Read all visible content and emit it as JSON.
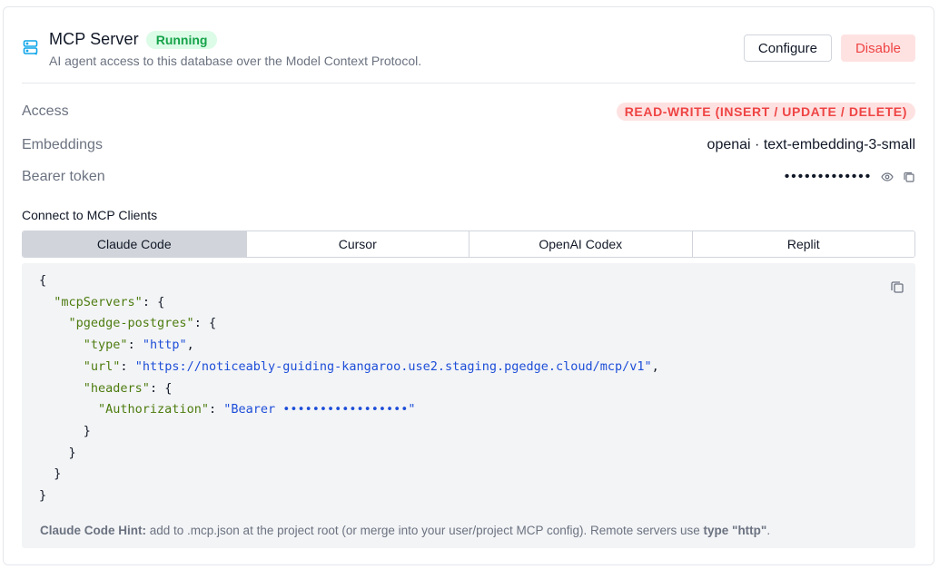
{
  "header": {
    "icon": "server-icon",
    "title": "MCP Server",
    "status": "Running",
    "subtitle": "AI agent access to this database over the Model Context Protocol.",
    "configure_label": "Configure",
    "disable_label": "Disable"
  },
  "details": {
    "access_label": "Access",
    "access_value": "READ-WRITE (INSERT / UPDATE / DELETE)",
    "embeddings_label": "Embeddings",
    "embeddings_value": "openai · text-embedding-3-small",
    "token_label": "Bearer token",
    "token_value": "•••••••••••••",
    "token_icons": [
      "eye-icon",
      "copy-icon"
    ]
  },
  "connect": {
    "title": "Connect to MCP Clients",
    "tabs": [
      "Claude Code",
      "Cursor",
      "OpenAI Codex",
      "Replit"
    ],
    "active_tab": "Claude Code",
    "code": {
      "key_mcpServers": "\"mcpServers\"",
      "key_server": "\"pgedge-postgres\"",
      "key_type": "\"type\"",
      "val_type": "\"http\"",
      "key_url": "\"url\"",
      "val_url": "\"https://noticeably-guiding-kangaroo.use2.staging.pgedge.cloud/mcp/v1\"",
      "key_headers": "\"headers\"",
      "key_auth": "\"Authorization\"",
      "val_auth": "\"Bearer •••••••••••••••••\""
    },
    "hint": {
      "label": "Claude Code Hint:",
      "text": " add to .mcp.json at the project root (or merge into your user/project MCP config). Remote servers use ",
      "strong2": "type \"http\"",
      "end": "."
    }
  },
  "colors": {
    "running_bg": "#dcfce7",
    "running_fg": "#16a34a",
    "danger_bg": "#fee2e2",
    "danger_fg": "#ef4444",
    "code_key": "#4d7c0f",
    "code_string": "#1d4ed8"
  }
}
